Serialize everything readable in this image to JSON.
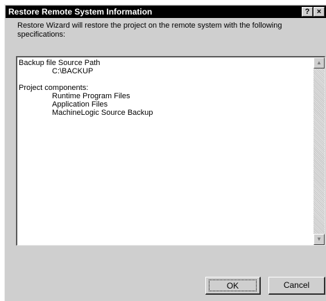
{
  "window": {
    "title": "Restore Remote System Information",
    "help_label": "?",
    "close_label": "×"
  },
  "description": "Restore Wizard will restore the project on the remote system with the following specifications:",
  "details": {
    "backup_heading": "Backup file Source Path",
    "backup_path": "C:\\BACKUP",
    "components_heading": "Project components:",
    "components": [
      "Runtime Program Files",
      "Application Files",
      "MachineLogic Source Backup"
    ]
  },
  "scrollbar": {
    "up_icon": "▲",
    "down_icon": "▼"
  },
  "buttons": {
    "ok": "OK",
    "cancel": "Cancel"
  }
}
